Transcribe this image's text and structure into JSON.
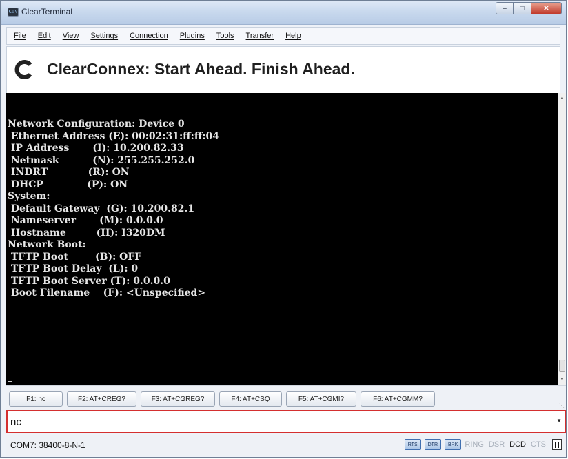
{
  "window": {
    "title": "ClearTerminal",
    "icon": "terminal-app-icon"
  },
  "menu": [
    "File",
    "Edit",
    "View",
    "Settings",
    "Connection",
    "Plugins",
    "Tools",
    "Transfer",
    "Help"
  ],
  "banner": {
    "tagline": "ClearConnex: Start Ahead. Finish Ahead.",
    "logo": "clearconnex-logo",
    "brand_color": "#1f1f1f"
  },
  "terminal": {
    "lines": [
      "Network Configuration: Device 0",
      " Ethernet Address (E): 00:02:31:ff:ff:04",
      " IP Address       (I): 10.200.82.33",
      " Netmask          (N): 255.255.252.0",
      " INDRT            (R): ON",
      " DHCP             (P): ON",
      "System:",
      " Default Gateway  (G): 10.200.82.1",
      " Nameserver       (M): 0.0.0.0",
      " Hostname         (H): I320DM",
      "Network Boot:",
      " TFTP Boot        (B): OFF",
      " TFTP Boot Delay  (L): 0",
      " TFTP Boot Server (T): 0.0.0.0",
      " Boot Filename    (F): <Unspecified>"
    ],
    "background": "#000000",
    "foreground": "#e6e6e6"
  },
  "function_keys": [
    "F1: nc",
    "F2: AT+CREG?",
    "F3: AT+CGREG?",
    "F4: AT+CSQ",
    "F5: AT+CGMI?",
    "F6: AT+CGMM?"
  ],
  "command_input": {
    "value": "nc"
  },
  "status": {
    "port": "COM7: 38400-8-N-1",
    "buttons": [
      "RTS",
      "DTR",
      "BRK"
    ],
    "indicators": [
      {
        "label": "RING",
        "active": false
      },
      {
        "label": "DSR",
        "active": false
      },
      {
        "label": "DCD",
        "active": true
      },
      {
        "label": "CTS",
        "active": false
      }
    ]
  },
  "colors": {
    "input_border": "#d42f2f",
    "signal_button": "#3f6fb0"
  }
}
